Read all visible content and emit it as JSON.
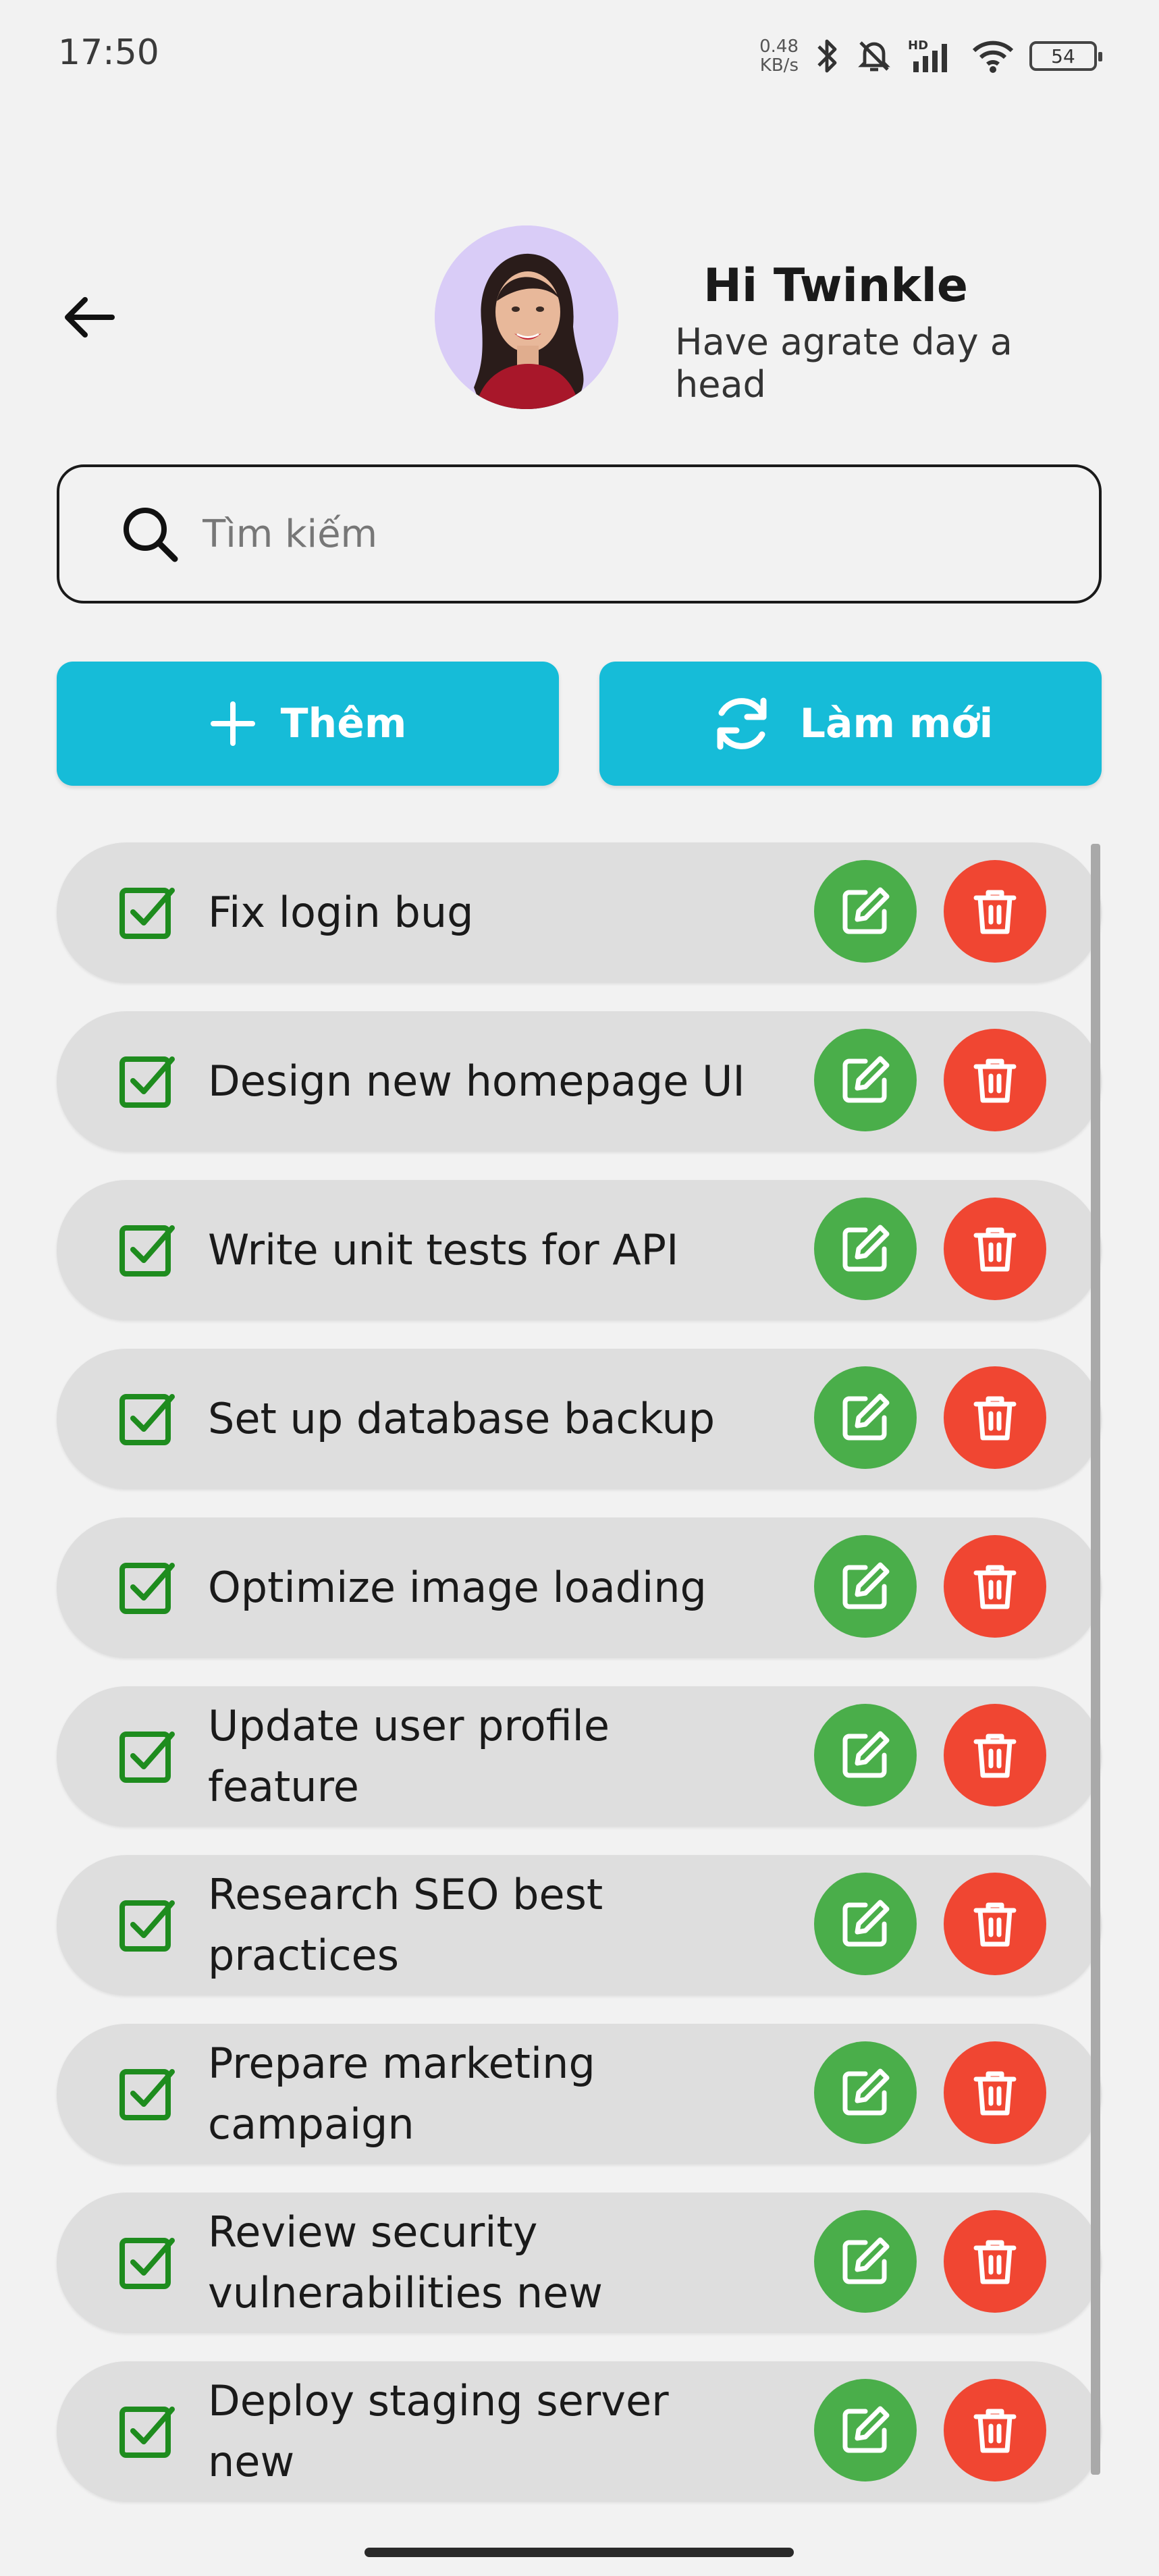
{
  "status_bar": {
    "time": "17:50",
    "net_speed_value": "0.48",
    "net_speed_unit": "KB/s",
    "battery": "54",
    "icons": [
      "bluetooth-icon",
      "mute-bell-icon",
      "hd-signal-icon",
      "wifi-icon",
      "battery-icon"
    ]
  },
  "header": {
    "greeting_title": "Hi Twinkle",
    "greeting_subtitle": "Have agrate day a head"
  },
  "search": {
    "placeholder": "Tìm kiếm",
    "value": ""
  },
  "actions": {
    "add_label": "Thêm",
    "refresh_label": "Làm mới"
  },
  "colors": {
    "accent": "#16bcd8",
    "edit": "#4aae4a",
    "delete": "#f04632",
    "check": "#1e8c1e",
    "row_bg": "#dedede"
  },
  "tasks": [
    {
      "title": "Fix login bug",
      "done": true
    },
    {
      "title": "Design new homepage UI",
      "done": true
    },
    {
      "title": "Write unit tests for API",
      "done": true
    },
    {
      "title": "Set up database backup",
      "done": true
    },
    {
      "title": "Optimize image loading",
      "done": true
    },
    {
      "title": "Update user profile feature",
      "done": true
    },
    {
      "title": "Research SEO best practices",
      "done": true
    },
    {
      "title": "Prepare marketing campaign",
      "done": true
    },
    {
      "title": "Review security vulnerabilities new",
      "done": true
    },
    {
      "title": "Deploy staging server new",
      "done": true
    }
  ]
}
